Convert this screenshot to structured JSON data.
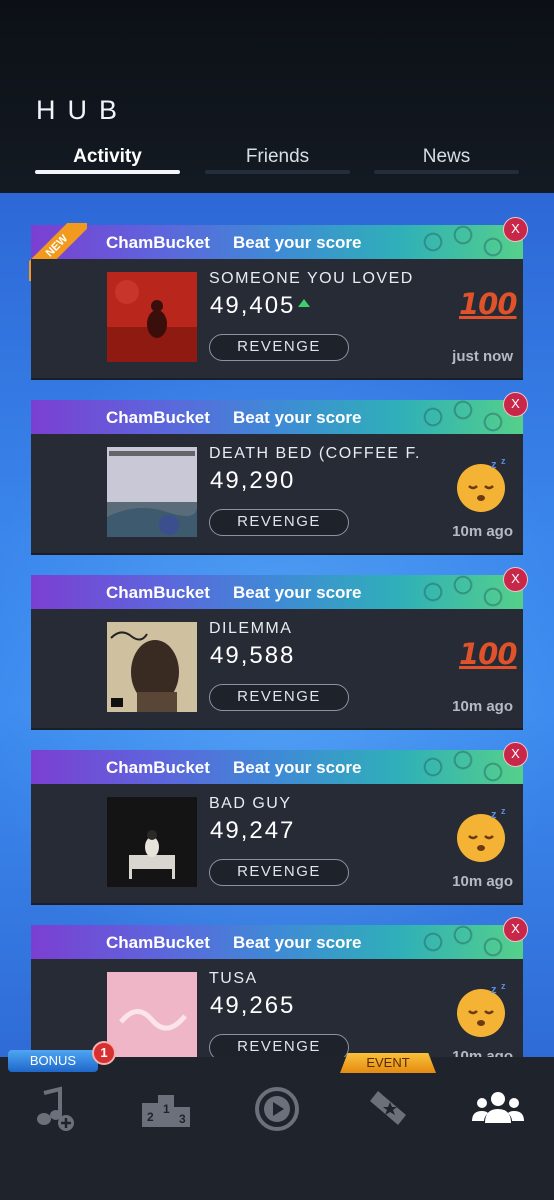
{
  "header": {
    "title": "HUB",
    "tabs": [
      {
        "label": "Activity",
        "active": true
      },
      {
        "label": "Friends",
        "active": false
      },
      {
        "label": "News",
        "active": false
      }
    ]
  },
  "feed": [
    {
      "user": "ChamBucket",
      "message": "Beat your score",
      "song": "SOMEONE YOU LOVED",
      "score": "49,405",
      "score_up": true,
      "button": "REVENGE",
      "time": "just now",
      "reaction": "hundred-icon",
      "new": true,
      "new_label": "NEW",
      "close": "X"
    },
    {
      "user": "ChamBucket",
      "message": "Beat your score",
      "song": "DEATH BED (COFFEE F...",
      "score": "49,290",
      "score_up": false,
      "button": "REVENGE",
      "time": "10m ago",
      "reaction": "sleepy-face-icon",
      "new": false,
      "close": "X"
    },
    {
      "user": "ChamBucket",
      "message": "Beat your score",
      "song": "DILEMMA",
      "score": "49,588",
      "score_up": false,
      "button": "REVENGE",
      "time": "10m ago",
      "reaction": "hundred-icon",
      "new": false,
      "close": "X"
    },
    {
      "user": "ChamBucket",
      "message": "Beat your score",
      "song": "BAD GUY",
      "score": "49,247",
      "score_up": false,
      "button": "REVENGE",
      "time": "10m ago",
      "reaction": "sleepy-face-icon",
      "new": false,
      "close": "X"
    },
    {
      "user": "ChamBucket",
      "message": "Beat your score",
      "song": "TUSA",
      "score": "49,265",
      "score_up": false,
      "button": "REVENGE",
      "time": "10m ago",
      "reaction": "sleepy-face-icon",
      "new": false,
      "close": "X"
    }
  ],
  "hundred_text": "100",
  "navbar": {
    "bonus_label": "BONUS",
    "bonus_count": "1",
    "event_label": "EVENT",
    "items": [
      {
        "icon": "music-add-icon",
        "active": false
      },
      {
        "icon": "leaderboard-podium-icon",
        "active": false
      },
      {
        "icon": "play-icon",
        "active": false
      },
      {
        "icon": "ticket-icon",
        "active": false
      },
      {
        "icon": "friends-group-icon",
        "active": true
      }
    ]
  },
  "colors": {
    "accent_new": "#f19a1e",
    "close": "#c9274a",
    "score_up": "#3ecf6a"
  }
}
